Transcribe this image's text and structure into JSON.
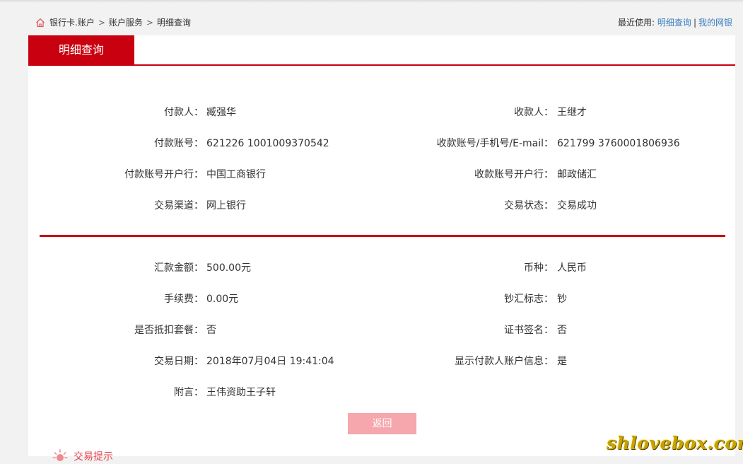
{
  "breadcrumb": {
    "items": [
      "银行卡.账户",
      "账户服务",
      "明细查询"
    ],
    "separator": ">"
  },
  "recent": {
    "label": "最近使用:",
    "links": [
      "明细查询",
      "我的网银"
    ],
    "separator": "|"
  },
  "tab": {
    "label": "明细查询"
  },
  "details": {
    "payer_label": "付款人：",
    "payer_value": "臧强华",
    "payee_label": "收款人：",
    "payee_value": "王继才",
    "payer_account_label": "付款账号：",
    "payer_account_value": "621226 1001009370542",
    "payee_account_label": "收款账号/手机号/E-mail：",
    "payee_account_value": "621799 3760001806936",
    "payer_bank_label": "付款账号开户行：",
    "payer_bank_value": "中国工商银行",
    "payee_bank_label": "收款账号开户行：",
    "payee_bank_value": "邮政储汇",
    "channel_label": "交易渠道：",
    "channel_value": "网上银行",
    "status_label": "交易状态：",
    "status_value": "交易成功",
    "amount_label": "汇款金额：",
    "amount_value": "500.00元",
    "currency_label": "币种：",
    "currency_value": "人民币",
    "fee_label": "手续费：",
    "fee_value": "0.00元",
    "cash_flag_label": "钞汇标志：",
    "cash_flag_value": "钞",
    "package_label": "是否抵扣套餐：",
    "package_value": "否",
    "cert_label": "证书签名：",
    "cert_value": "否",
    "date_label": "交易日期：",
    "date_value": "2018年07月04日 19:41:04",
    "show_info_label": "显示付款人账户信息：",
    "show_info_value": "是",
    "note_label": "附言：",
    "note_value": "王伟资助王子轩"
  },
  "buttons": {
    "back_label": "返回"
  },
  "tips": {
    "label": "交易提示"
  },
  "watermark": {
    "text": "shlovebox.com"
  },
  "colors": {
    "brand_red": "#c9000f",
    "link_blue": "#3a7fc0",
    "button_pink": "#f6a6ad",
    "background": "#f2f2f2"
  }
}
